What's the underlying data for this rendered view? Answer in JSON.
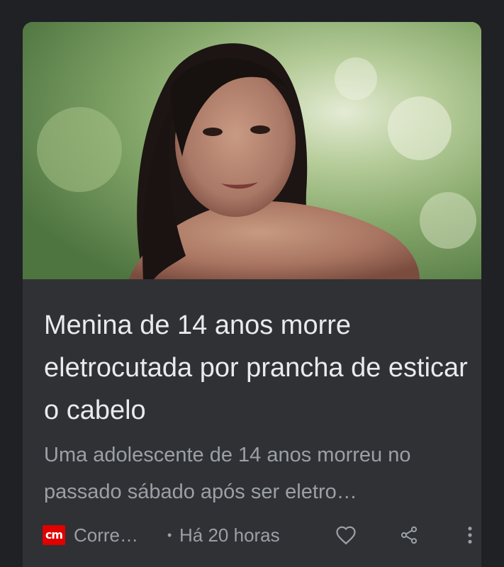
{
  "article": {
    "image_alt": "Menina de 14 anos",
    "title": "Menina de 14 anos morre eletrocutada por prancha de esticar o cabelo",
    "snippet": "Uma adolescente de 14 anos morreu no passado sábado após ser eletro…",
    "source_logo_text": "cm",
    "source_name": "Corre…",
    "separator": "•",
    "time": "Há 20 horas"
  },
  "icons": {
    "like": "heart-icon",
    "share": "share-icon",
    "more": "more-vert-icon"
  },
  "colors": {
    "background": "#202124",
    "card": "#303134",
    "title_text": "#e8eaed",
    "secondary_text": "#9aa0a6",
    "logo_red": "#e00000"
  }
}
